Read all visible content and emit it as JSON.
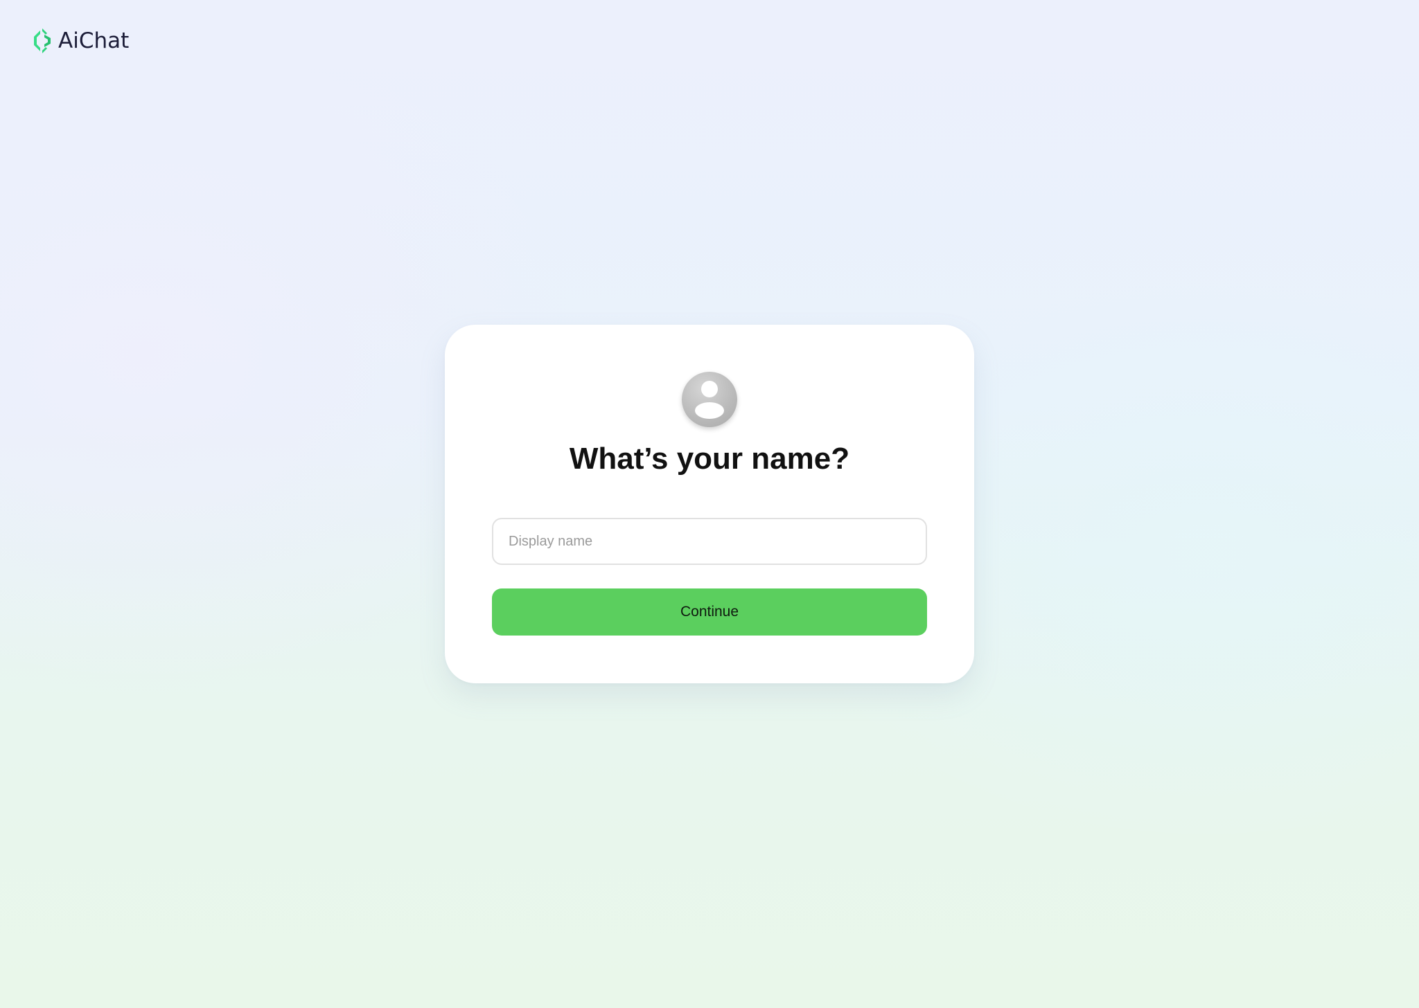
{
  "app": {
    "name": "AiChat"
  },
  "card": {
    "title": "What’s your name?",
    "display_name_input": {
      "value": "",
      "placeholder": "Display name"
    },
    "continue_label": "Continue"
  },
  "colors": {
    "brand_green": "#33d67a",
    "button_green": "#5bcf5e",
    "logo_text": "#1c1d38"
  },
  "icons": {
    "logo": "aichat-logo-icon",
    "avatar": "user-avatar-icon"
  }
}
